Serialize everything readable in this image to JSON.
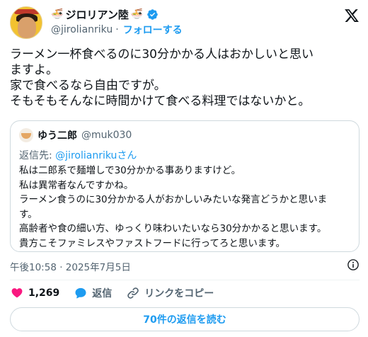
{
  "author": {
    "display_name": "ジロリアン陸",
    "handle": "@jirolianriku",
    "separator": "·",
    "follow_label": "フォローする"
  },
  "tweet": {
    "lines": [
      "ラーメン一杯食べるのに30分かかる人はおかしいと思い",
      "ますよ。",
      "家で食べるなら自由ですが。",
      "そもそもそんなに時間かけて食べる料理ではないかと。"
    ]
  },
  "quote": {
    "display_name": "ゆう二郎",
    "handle": "@muk030",
    "reply_prefix": "返信先: ",
    "reply_to": "@jirolianrikuさん",
    "lines": [
      "私は二郎系で麺増しで30分かかる事ありますけど。",
      "私は異常者なんですかね。",
      "ラーメン食うのに30分かかる人がおかしいみたいな発言どうかと思いま",
      "す。",
      "高齢者や食の細い方、ゆっくり味わいたいなら30分かかると思います。",
      "貴方こそファミレスやファストフードに行ってろと思います。"
    ]
  },
  "timestamp": "午後10:58 · 2025年7月5日",
  "actions": {
    "like_count": "1,269",
    "reply_label": "返信",
    "copy_link_label": "リンクをコピー"
  },
  "read_replies_label": "70件の返信を読む",
  "colors": {
    "accent": "#1d9bf0",
    "like": "#f91880",
    "muted": "#536471",
    "border": "#cfd9de"
  },
  "icons": [
    "verified-badge-icon",
    "x-logo-icon",
    "info-icon",
    "heart-icon",
    "reply-bubble-icon",
    "link-icon",
    "ramen-bowl-icon"
  ]
}
